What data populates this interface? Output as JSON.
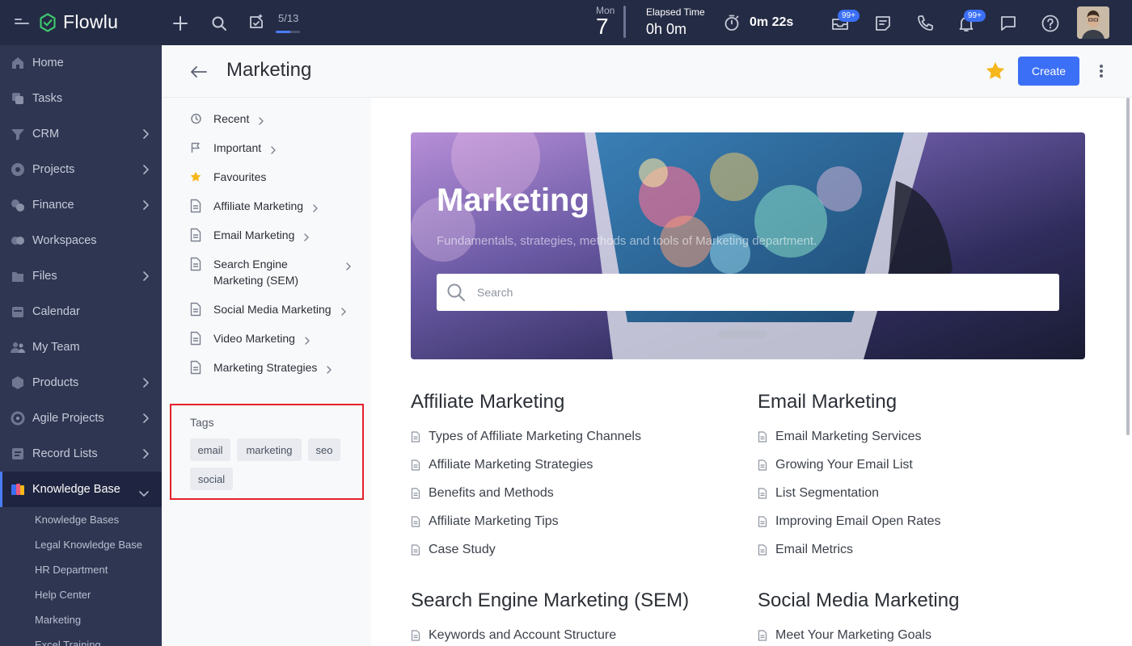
{
  "app": {
    "name": "Flowlu"
  },
  "topbar": {
    "progress_label": "5/13",
    "progress_fraction": 0.6,
    "date_dow": "Mon",
    "date_day": "7",
    "elapsed_label": "Elapsed Time",
    "elapsed_value": "0h 0m",
    "timer_value": "0m 22s",
    "mail_badge": "99+",
    "notif_badge": "99+"
  },
  "sidebar": {
    "items": [
      {
        "label": "Home",
        "icon": "home-icon",
        "chevron": false
      },
      {
        "label": "Tasks",
        "icon": "tasks-icon",
        "chevron": false
      },
      {
        "label": "CRM",
        "icon": "crm-icon",
        "chevron": true
      },
      {
        "label": "Projects",
        "icon": "projects-icon",
        "chevron": true
      },
      {
        "label": "Finance",
        "icon": "finance-icon",
        "chevron": true
      },
      {
        "label": "Workspaces",
        "icon": "workspaces-icon",
        "chevron": false
      },
      {
        "label": "Files",
        "icon": "files-icon",
        "chevron": true
      },
      {
        "label": "Calendar",
        "icon": "calendar-icon",
        "chevron": false
      },
      {
        "label": "My Team",
        "icon": "team-icon",
        "chevron": false
      },
      {
        "label": "Products",
        "icon": "products-icon",
        "chevron": true
      },
      {
        "label": "Agile Projects",
        "icon": "agile-icon",
        "chevron": true
      },
      {
        "label": "Record Lists",
        "icon": "record-lists-icon",
        "chevron": true
      },
      {
        "label": "Knowledge Base",
        "icon": "knowledge-base-icon",
        "chevron": true,
        "active": true
      }
    ],
    "subitems": [
      "Knowledge Bases",
      "Legal Knowledge Base",
      "HR Department",
      "Help Center",
      "Marketing",
      "Excel Training"
    ]
  },
  "header": {
    "title": "Marketing",
    "create_label": "Create"
  },
  "panel": {
    "items": [
      {
        "label": "Recent",
        "icon": "history-icon"
      },
      {
        "label": "Important",
        "icon": "flag-icon"
      },
      {
        "label": "Favourites",
        "icon": "star-icon"
      },
      {
        "label": "Affiliate Marketing",
        "icon": "document-icon"
      },
      {
        "label": "Email Marketing",
        "icon": "document-icon"
      },
      {
        "label": "Search Engine Marketing (SEM)",
        "icon": "document-icon"
      },
      {
        "label": "Social Media Marketing",
        "icon": "document-icon"
      },
      {
        "label": "Video Marketing",
        "icon": "document-icon"
      },
      {
        "label": "Marketing Strategies",
        "icon": "document-icon"
      }
    ],
    "tags_title": "Tags",
    "tags": [
      "email",
      "marketing",
      "seo",
      "social"
    ]
  },
  "hero": {
    "title": "Marketing",
    "subtitle": "Fundamentals, strategies, methods and tools of Marketing department.",
    "search_placeholder": "Search"
  },
  "sections": [
    {
      "title": "Affiliate Marketing",
      "articles": [
        "Types of Affiliate Marketing Channels",
        "Affiliate Marketing Strategies",
        "Benefits and Methods",
        "Affiliate Marketing Tips",
        "Case Study"
      ]
    },
    {
      "title": "Email Marketing",
      "articles": [
        "Email Marketing Services",
        "Growing Your Email List",
        "List Segmentation",
        "Improving Email Open Rates",
        "Email Metrics"
      ]
    },
    {
      "title": "Search Engine Marketing (SEM)",
      "articles": [
        "Keywords and Account Structure"
      ]
    },
    {
      "title": "Social Media Marketing",
      "articles": [
        "Meet Your Marketing Goals"
      ]
    }
  ]
}
